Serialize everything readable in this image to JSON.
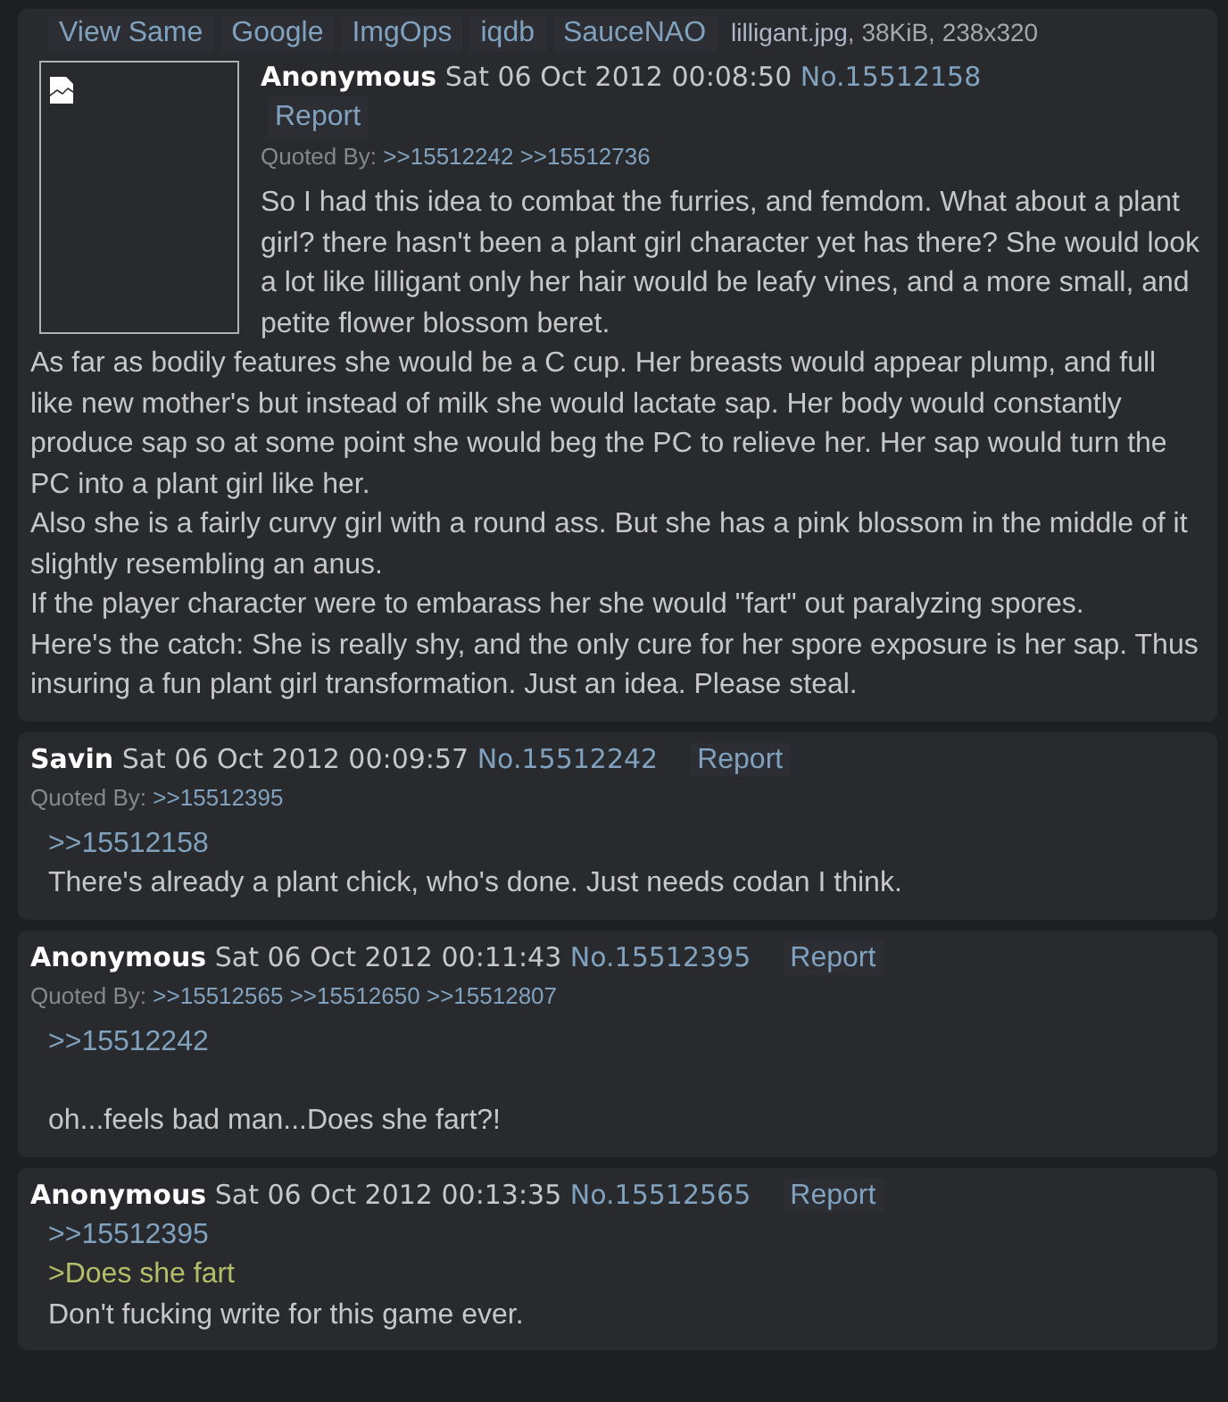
{
  "op": {
    "file_links": [
      "View Same",
      "Google",
      "ImgOps",
      "iqdb",
      "SauceNAO"
    ],
    "file_info": {
      "name": "lilligant.jpg",
      "details": ", 38KiB, 238x320"
    },
    "name": "Anonymous",
    "date": "Sat 06 Oct 2012 00:08:50",
    "number": "No.15512158",
    "report": "Report",
    "quoted_by_label": "Quoted By:",
    "quoted_by": [
      ">>15512242",
      ">>15512736"
    ],
    "body": [
      {
        "kind": "text",
        "text": "So I had this idea to combat the furries, and femdom. What about a plant girl? there hasn't been a plant girl character yet has there? She would look a lot like lilligant only her hair would be leafy vines, and a more small, and petite flower blossom beret."
      },
      {
        "kind": "text",
        "text": "As far as bodily features she would be a C cup. Her breasts would appear plump, and full like new mother's but instead of milk she would lactate sap. Her body would constantly produce sap so at some point she would beg the PC to relieve her. Her sap would turn the PC into a plant girl like her."
      },
      {
        "kind": "text",
        "text": "Also she is a fairly curvy girl with a round ass. But she has a pink blossom in the middle of it slightly resembling an anus."
      },
      {
        "kind": "text",
        "text": "If the player character were to embarass her she would \"fart\" out paralyzing spores."
      },
      {
        "kind": "text",
        "text": "Here's the catch: She is really shy, and the only cure for her spore exposure is her sap. Thus insuring a fun plant girl transformation. Just an idea. Please steal."
      }
    ]
  },
  "replies": [
    {
      "name": "Savin",
      "date": "Sat 06 Oct 2012 00:09:57",
      "number": "No.15512242",
      "report": "Report",
      "quoted_by_label": "Quoted By:",
      "quoted_by": [
        ">>15512395"
      ],
      "body": [
        {
          "kind": "quotelink",
          "text": ">>15512158"
        },
        {
          "kind": "text",
          "text": "There's already a plant chick, who's done. Just needs codan I think."
        }
      ]
    },
    {
      "name": "Anonymous",
      "date": "Sat 06 Oct 2012 00:11:43",
      "number": "No.15512395",
      "report": "Report",
      "quoted_by_label": "Quoted By:",
      "quoted_by": [
        ">>15512565",
        ">>15512650",
        ">>15512807"
      ],
      "body": [
        {
          "kind": "quotelink",
          "text": ">>15512242"
        },
        {
          "kind": "text",
          "text": "oh...feels bad man...Does she fart?!",
          "blank_line_before": true
        }
      ]
    },
    {
      "name": "Anonymous",
      "date": "Sat 06 Oct 2012 00:13:35",
      "number": "No.15512565",
      "report": "Report",
      "body": [
        {
          "kind": "quotelink",
          "text": ">>15512395"
        },
        {
          "kind": "greentext",
          "text": ">Does she fart"
        },
        {
          "kind": "text",
          "text": "Don't fucking write for this game ever."
        }
      ]
    }
  ]
}
